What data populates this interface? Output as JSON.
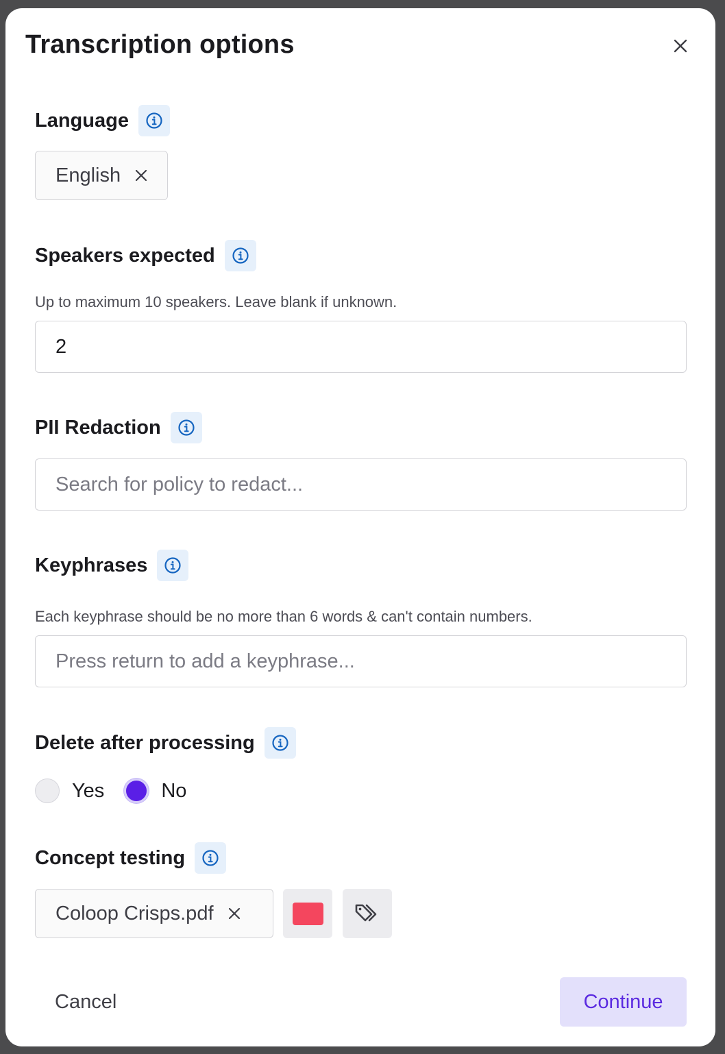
{
  "dialog": {
    "title": "Transcription options",
    "close_icon": "close-icon"
  },
  "language": {
    "label": "Language",
    "info_icon": "info-icon",
    "selected": "English",
    "remove_icon": "close-icon"
  },
  "speakers": {
    "label": "Speakers expected",
    "help": "Up to maximum 10 speakers. Leave blank if unknown.",
    "value": "2"
  },
  "pii": {
    "label": "PII Redaction",
    "placeholder": "Search for policy to redact..."
  },
  "keyphrases": {
    "label": "Keyphrases",
    "help": "Each keyphrase should be no more than 6 words & can't contain numbers.",
    "placeholder": "Press return to add a keyphrase..."
  },
  "delete_after": {
    "label": "Delete after processing",
    "options": [
      "Yes",
      "No"
    ],
    "selected": "No"
  },
  "concept_testing": {
    "label": "Concept testing",
    "file": "Coloop Crisps.pdf",
    "swatch_color": "#f4465e",
    "tag_icon": "tags-icon"
  },
  "footer": {
    "cancel": "Cancel",
    "continue": "Continue"
  },
  "colors": {
    "accent": "#5a1fe6",
    "info": "#1565c0",
    "continue_bg": "#e3e0fb",
    "continue_text": "#5b2be0"
  }
}
